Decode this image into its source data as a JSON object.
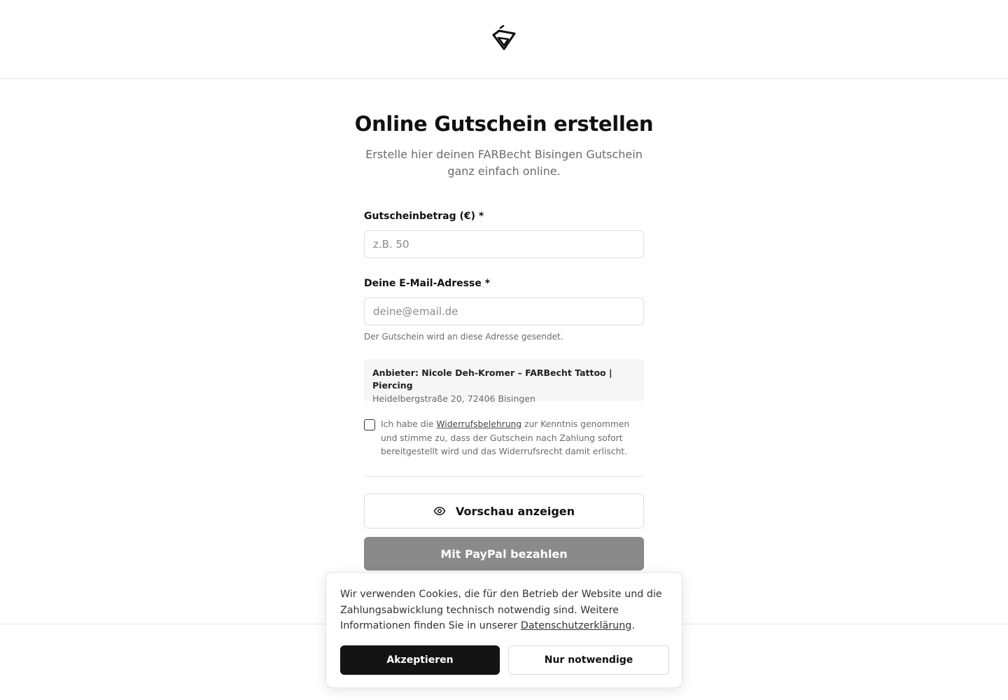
{
  "header": {
    "logo_icon": "diamond-logo-icon"
  },
  "form": {
    "title": "Online Gutschein erstellen",
    "subtitle": "Erstelle hier deinen FARBecht Bisingen Gutschein ganz einfach online.",
    "amount_label": "Gutscheinbetrag (€) *",
    "amount_value": "",
    "amount_placeholder": "z.B. 50",
    "email_label": "Deine E-Mail-Adresse *",
    "email_value": "",
    "email_placeholder": "deine@email.de",
    "email_hint": "Der Gutschein wird an diese Adresse gesendet.",
    "provider_name": "Anbieter: Nicole Deh-Kromer – FARBecht Tattoo | Piercing",
    "provider_address": "Heidelbergstraße 20, 72406 Bisingen",
    "consent_checked": false,
    "consent_before": "Ich habe die ",
    "consent_link": "Widerrufsbelehrung",
    "consent_after": " zur Kenntnis genommen und stimme zu, dass der Gutschein nach Zahlung sofort bereitgestellt wird und das Widerrufsrecht damit erlischt.",
    "preview_button": "Vorschau anzeigen",
    "preview_icon": "eye-icon",
    "paypal_button": "Mit PayPal bezahlen"
  },
  "cookie_banner": {
    "text_before": "Wir verwenden Cookies, die für den Betrieb der Website und die Zahlungsabwicklung technisch notwendig sind. Weitere Informationen finden Sie in unserer ",
    "link": "Datenschutzerklärung",
    "text_after": ".",
    "accept_button": "Akzeptieren",
    "necessary_button": "Nur notwendige"
  },
  "colors": {
    "text": "#111111",
    "muted": "#6b6b6b",
    "paypal_disabled": "#8a8a8a",
    "accept_bg": "#141414",
    "border": "#dcdcdc"
  }
}
